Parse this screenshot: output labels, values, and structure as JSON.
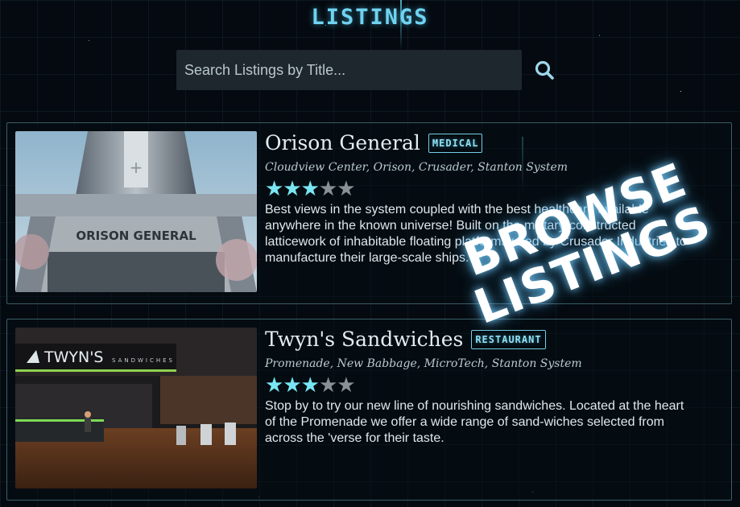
{
  "page": {
    "title": "LISTINGS"
  },
  "search": {
    "placeholder": "Search Listings by Title..."
  },
  "listings": [
    {
      "title": "Orison General",
      "badge": "MEDICAL",
      "location": "Cloudview Center, Orison, Crusader, Stanton System",
      "rating": 3,
      "rating_max": 5,
      "description": "Best views in the system coupled with the best healthcare available anywhere in the known universe! Built on the military-constructed latticework of inhabitable floating platforms used by Crusader Industries to manufacture their large-scale ships.",
      "image_sign": "ORISON GENERAL"
    },
    {
      "title": "Twyn's Sandwiches",
      "badge": "RESTAURANT",
      "location": "Promenade, New Babbage, MicroTech, Stanton System",
      "rating": 3,
      "rating_max": 5,
      "description": "Stop by to try our new line of nourishing sandwiches. Located at the heart of the Promenade we offer a wide range of sand-wiches selected from across the 'verse for their taste.",
      "image_sign": "TWYN'S",
      "image_sign_sub": "SANDWICHES"
    }
  ],
  "overlay": {
    "line1": "BROWSE",
    "line2": "LISTINGS"
  },
  "colors": {
    "accent": "#6fd3f1",
    "star_on": "#79e6f3",
    "star_off": "#8a9096",
    "card_border": "#3b5d66"
  },
  "icons": {
    "search": "search-icon",
    "star": "star-icon"
  }
}
